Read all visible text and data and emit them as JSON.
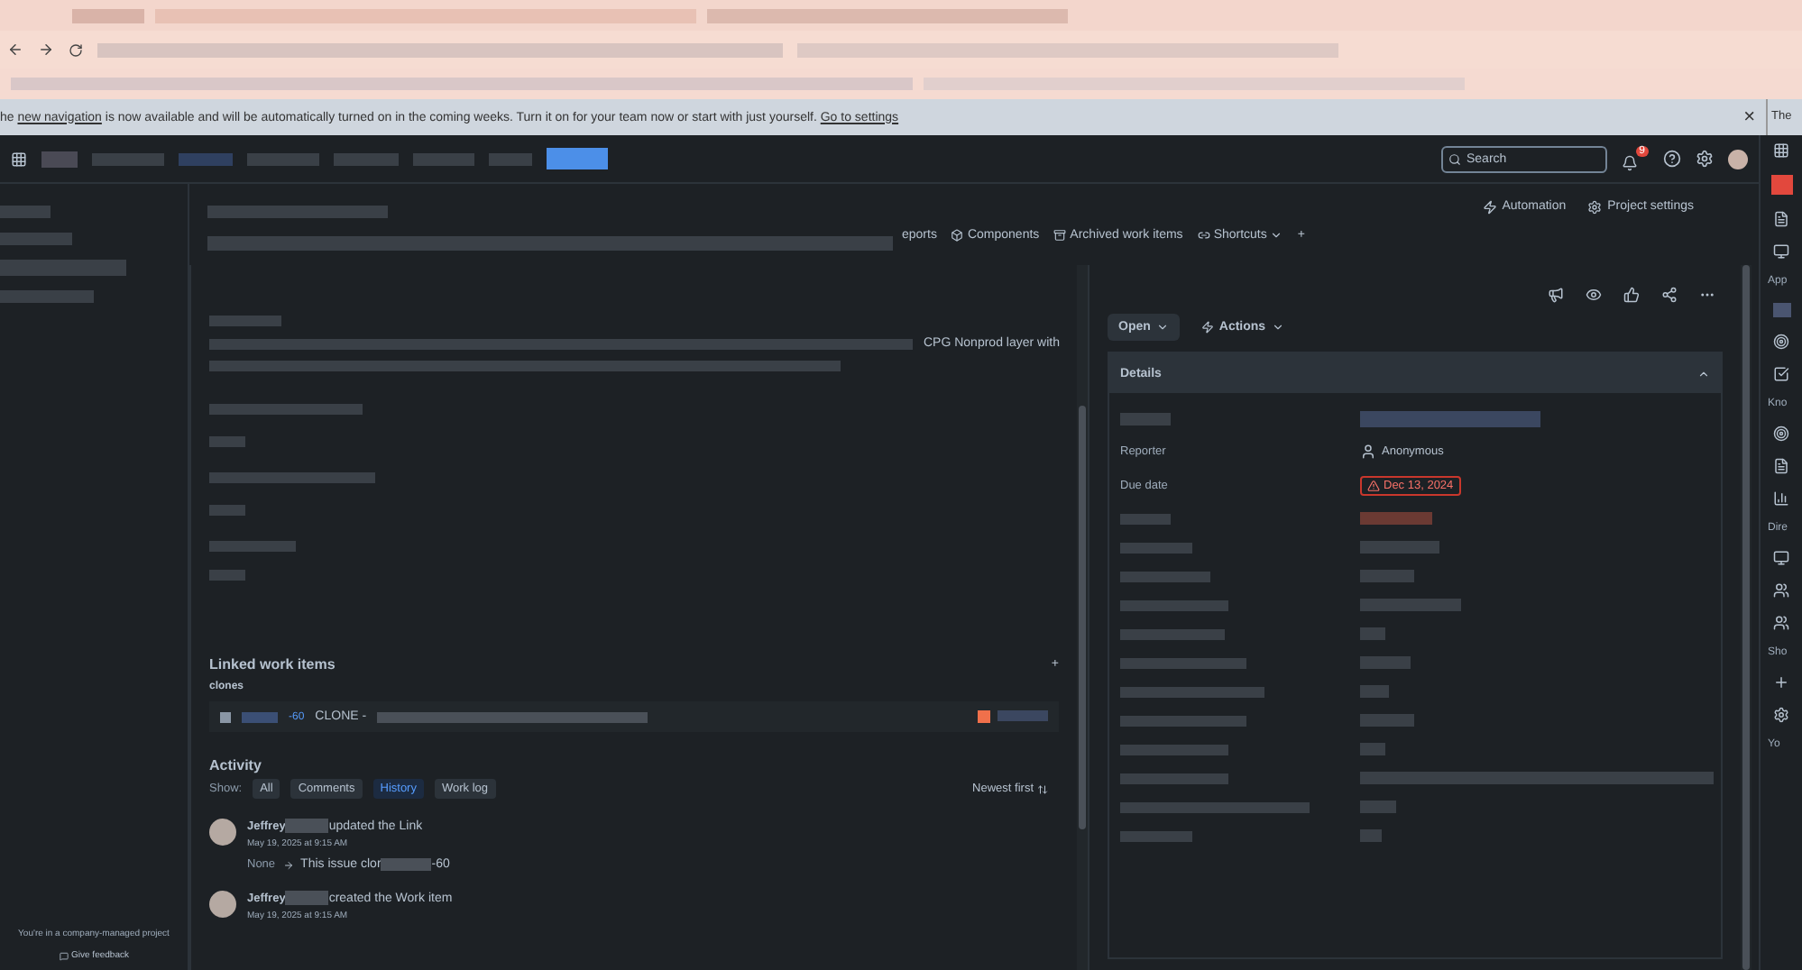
{
  "banner": {
    "lead": "he ",
    "link": "new navigation",
    "text": " is now available and will be automatically turned on in the coming weeks. Turn it on for your team now or start with just yourself.",
    "action": "Go to settings",
    "close": "×",
    "next_pane": "The"
  },
  "topnav": {
    "search": {
      "placeholder": "Search"
    },
    "notification_count": "9"
  },
  "header": {
    "actions": [
      "Automation",
      "Project settings"
    ],
    "tabs": [
      {
        "label": "eports",
        "dropdown": false
      },
      {
        "label": "Components",
        "dropdown": false
      },
      {
        "label": "Archived work items",
        "dropdown": false
      },
      {
        "label": "Shortcuts",
        "dropdown": true
      }
    ],
    "add": "+"
  },
  "description": {
    "visible_text": "CPG Nonprod layer with"
  },
  "linked": {
    "title": "Linked work items",
    "add": "+",
    "group": "clones",
    "item": {
      "key": "-60",
      "summary": "CLONE -"
    }
  },
  "activity": {
    "title": "Activity",
    "show_label": "Show:",
    "filters": [
      {
        "label": "All",
        "selected": false
      },
      {
        "label": "Comments",
        "selected": false
      },
      {
        "label": "History",
        "selected": true
      },
      {
        "label": "Work log",
        "selected": false
      }
    ],
    "sort": "Newest first",
    "entries": [
      {
        "author": "Jeffrey",
        "action": "updated the Link",
        "time": "May 19, 2025 at 9:15 AM",
        "change": {
          "from": "None",
          "to": "This issue clor",
          "to_end": "-60"
        }
      },
      {
        "author": "Jeffrey",
        "action": "created the Work item",
        "time": "May 19, 2025 at 9:15 AM"
      }
    ]
  },
  "issue_panel": {
    "status": "Open",
    "actions": "Actions",
    "details": {
      "title": "Details",
      "expanded": true,
      "fields": [
        {
          "label": "Reporter",
          "value": "Anonymous",
          "kind": "user"
        },
        {
          "label": "Due date",
          "value": "Dec 13, 2024",
          "kind": "overdue"
        }
      ]
    }
  },
  "sidebar_footer": {
    "text": "You're in a company-managed project",
    "feedback": "Give feedback"
  },
  "right_rail": {
    "sections": [
      "App",
      "Kno",
      "Dire",
      "Sho",
      "Yo"
    ]
  }
}
